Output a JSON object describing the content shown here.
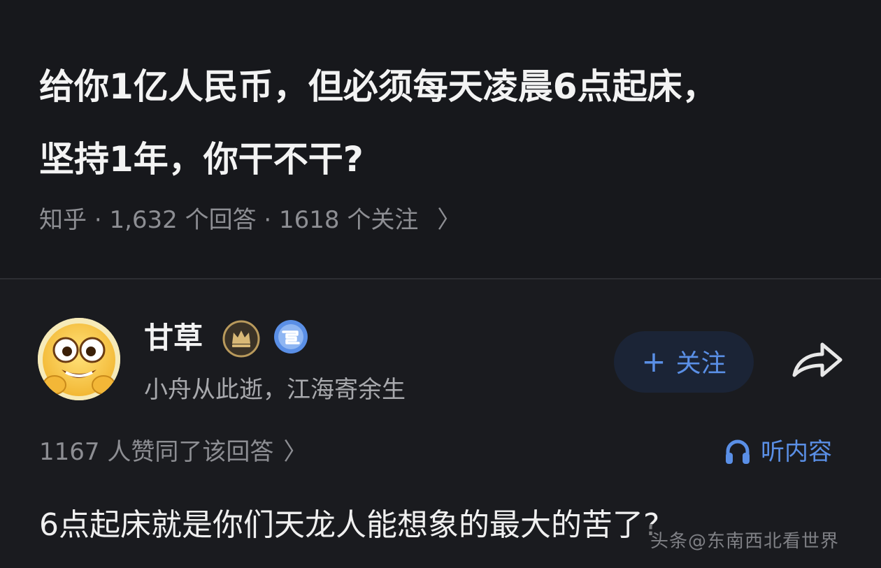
{
  "question": {
    "title_line1": "给你1亿人民币，但必须每天凌晨6点起床，",
    "title_line2": "坚持1年，你干不干?",
    "source": "知乎",
    "answers": "1,632 个回答",
    "followers": "1618 个关注",
    "separator": "·",
    "chevron": "〉"
  },
  "answer": {
    "author_name": "甘草",
    "author_bio": "小舟从此逝，江海寄余生",
    "follow_plus": "+",
    "follow_label": "关注",
    "likes": "1167 人赞同了该回答",
    "chevron": "〉",
    "listen_label": "听内容",
    "text": "6点起床就是你们天龙人能想象的最大的苦了?",
    "watermark": "头条@东南西北看世界"
  },
  "colors": {
    "accent": "#5a8fe6",
    "background": "#1a1b1f",
    "muted_text": "#8d8e93"
  }
}
